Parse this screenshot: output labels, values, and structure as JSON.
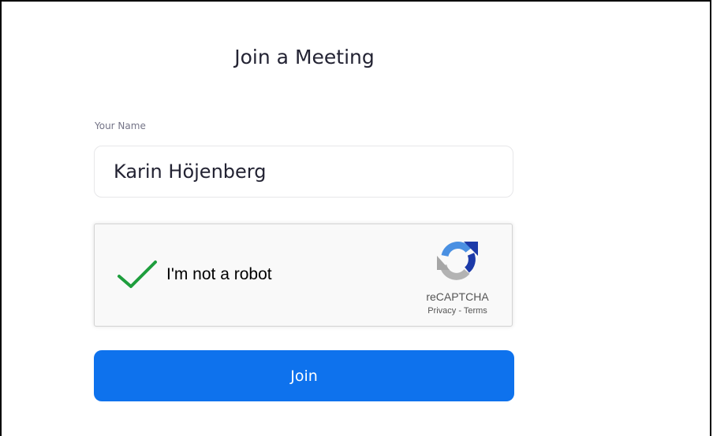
{
  "page": {
    "title": "Join a Meeting"
  },
  "name_field": {
    "label": "Your Name",
    "value": "Karin Höjenberg"
  },
  "recaptcha": {
    "checked": true,
    "label": "I'm not a robot",
    "brand": "reCAPTCHA",
    "privacy_label": "Privacy",
    "separator": "-",
    "terms_label": "Terms",
    "check_icon": "check-icon",
    "logo_icon": "recaptcha-logo-icon"
  },
  "join_button": {
    "label": "Join"
  },
  "colors": {
    "accent": "#0e72ed",
    "check": "#1e9e3d",
    "text": "#232333",
    "label": "#747487"
  }
}
